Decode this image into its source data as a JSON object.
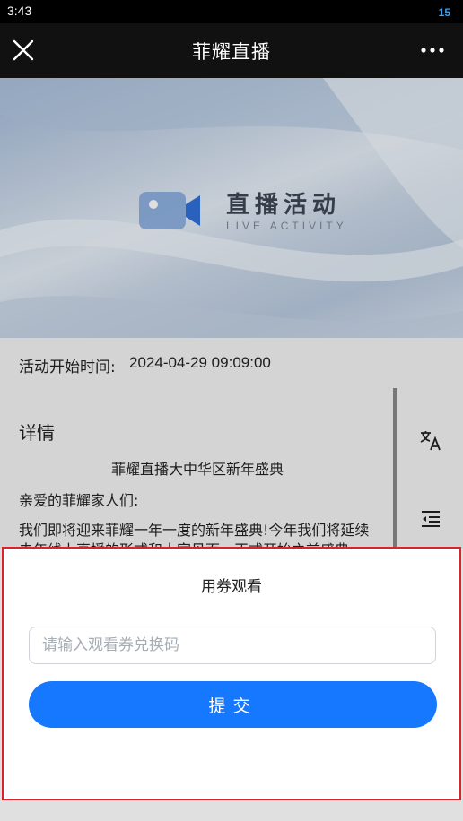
{
  "status_bar": {
    "time": "3:43",
    "battery": "15"
  },
  "nav": {
    "title": "菲耀直播",
    "close_icon": "close-icon",
    "more_icon": "more-icon"
  },
  "banner": {
    "title": "直播活动",
    "subtitle": "LIVE ACTIVITY",
    "icon": "video-camera-icon"
  },
  "event": {
    "start_label": "活动开始时间:",
    "start_value": "2024-04-29 09:09:00"
  },
  "details": {
    "heading": "详情",
    "center_title": "菲耀直播大中华区新年盛典",
    "greeting": "亲爱的菲耀家人们:",
    "body": "我们即将迎来菲耀一年一度的新年盛典!今年我们将延续去年线上直播的形式和大家见面，正式开始之前盛典"
  },
  "side_tools": {
    "translate_icon": "translate-icon",
    "outline_icon": "outline-icon"
  },
  "coupon_sheet": {
    "title": "用券观看",
    "input_placeholder": "请输入观看券兑换码",
    "input_value": "",
    "submit_label": "提交"
  },
  "colors": {
    "accent": "#1677ff",
    "highlight_border": "#d9232d",
    "nav_bg": "#111111"
  }
}
